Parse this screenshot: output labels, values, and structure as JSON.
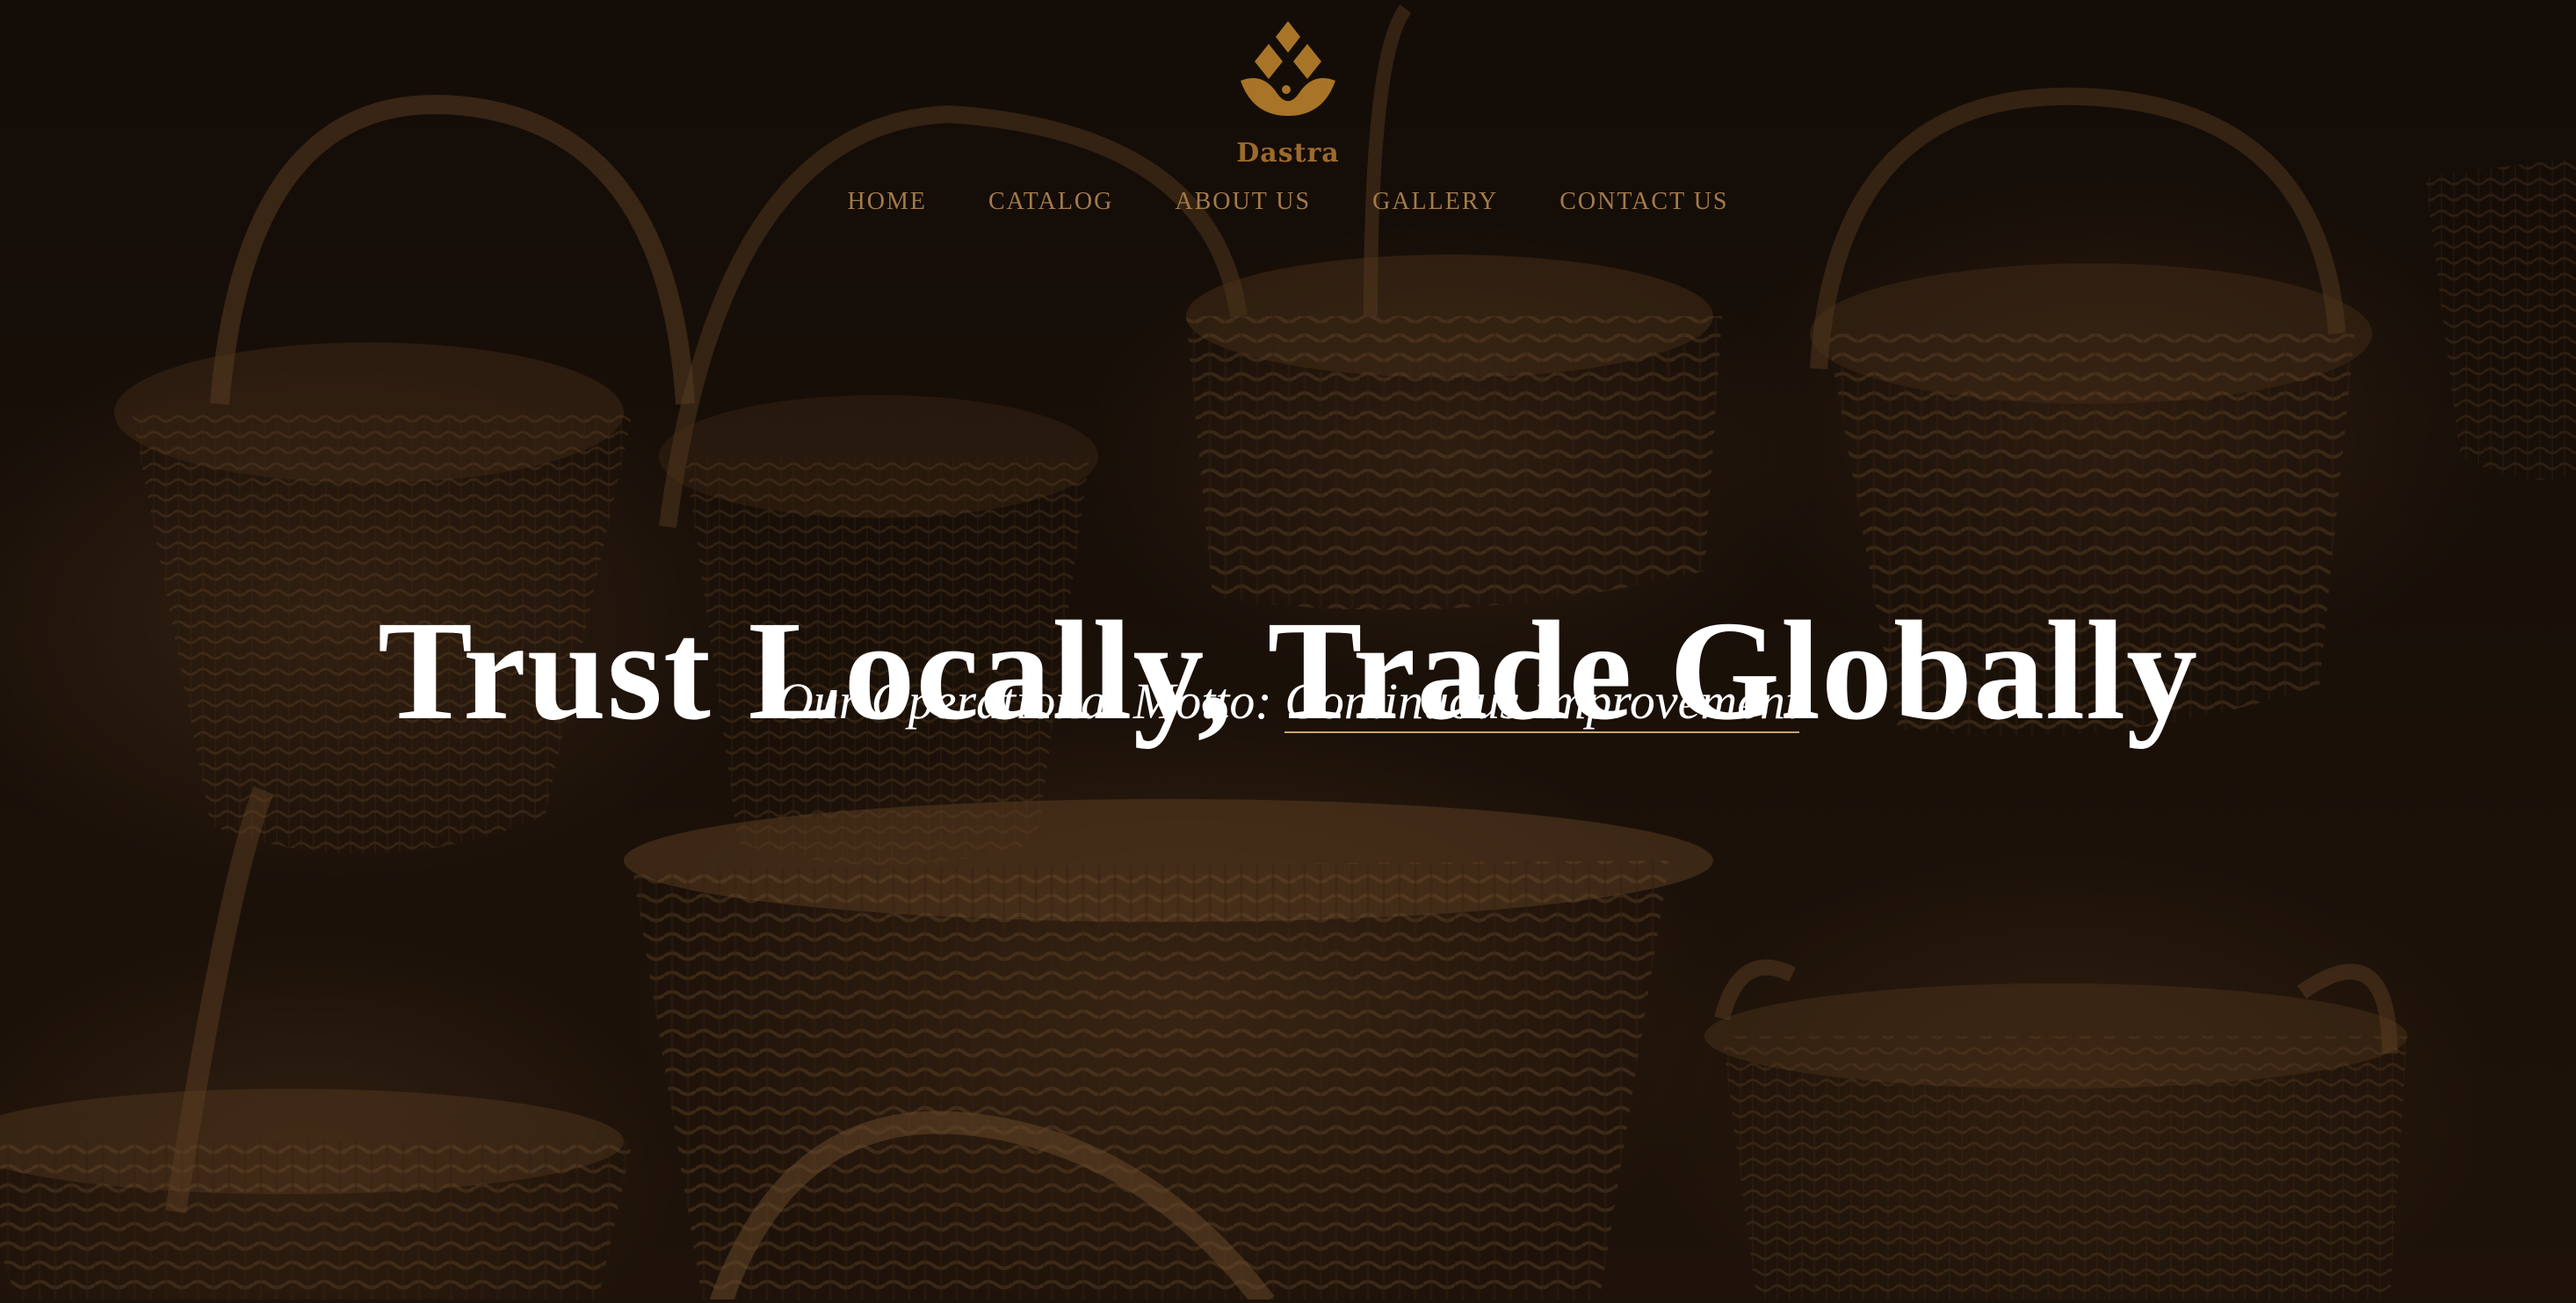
{
  "brand": {
    "name": "Dastra",
    "color": "#9c6a2c"
  },
  "nav": {
    "items": [
      {
        "label": "HOME"
      },
      {
        "label": "CATALOG"
      },
      {
        "label": "ABOUT US"
      },
      {
        "label": "GALLERY"
      },
      {
        "label": "CONTACT US"
      }
    ],
    "color": "#a47a4a"
  },
  "hero": {
    "title": "Trust Locally, Trade Globally",
    "motto_prefix": "Our Operational Motto: ",
    "motto_link": "Continuous Improvement",
    "background_subject": "wicker baskets photo",
    "text_color": "#ffffff",
    "underline_color": "#c9a46f"
  }
}
